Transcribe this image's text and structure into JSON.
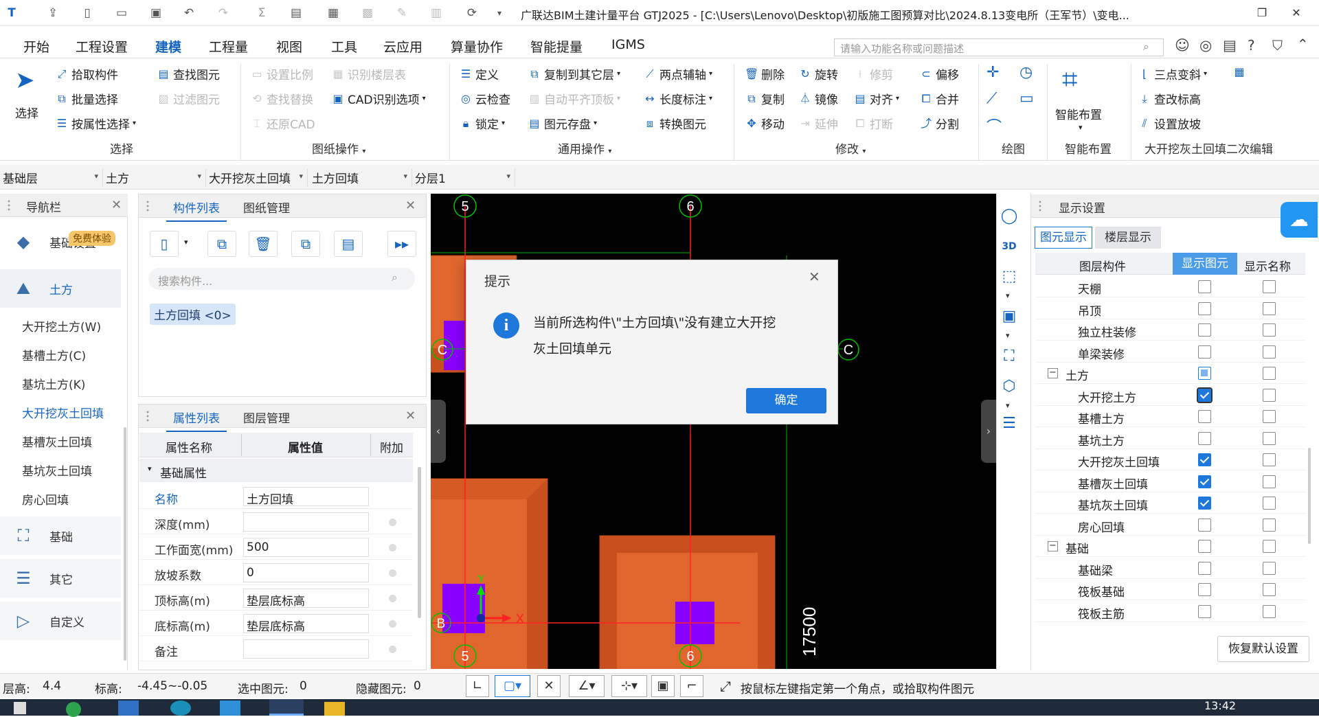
{
  "titlebar": {
    "title": "广联达BIM土建计量平台 GTJ2025 - [C:\\Users\\Lenovo\\Desktop\\初版施工图预算对比\\2024.8.13变电所（王军节）\\变电..."
  },
  "menu": {
    "items": [
      "开始",
      "工程设置",
      "建模",
      "工程量",
      "视图",
      "工具",
      "云应用",
      "算量协作",
      "智能提量",
      "IGMS"
    ],
    "active": "建模",
    "search_placeholder": "请输入功能名称或问题描述"
  },
  "ribbon": {
    "select": {
      "label": "选择",
      "group": "选择",
      "items": [
        "拾取构件",
        "批量选择",
        "按属性选择"
      ],
      "find": [
        "查找图元",
        "过滤图元"
      ]
    },
    "drawing": {
      "group": "图纸操作",
      "items": [
        "设置比例",
        "识别楼层表",
        "查找替换",
        "CAD识别选项",
        "还原CAD"
      ]
    },
    "common": {
      "group": "通用操作",
      "items": [
        "定义",
        "复制到其它层",
        "两点辅轴",
        "云检查",
        "自动平齐顶板",
        "长度标注",
        "锁定",
        "图元存盘",
        "转换图元"
      ]
    },
    "modify": {
      "group": "修改",
      "items": [
        "删除",
        "旋转",
        "修剪",
        "偏移",
        "复制",
        "镜像",
        "对齐",
        "合并",
        "移动",
        "延伸",
        "打断",
        "分割"
      ]
    },
    "draw": {
      "group": "绘图"
    },
    "smart": {
      "label": "智能布置",
      "group": "智能布置"
    },
    "edit2": {
      "group": "大开挖灰土回填二次编辑",
      "items": [
        "三点变斜",
        "查改标高",
        "设置放坡"
      ]
    }
  },
  "propbar": {
    "floor": "基础层",
    "type": "土方",
    "subtype": "大开挖灰土回填",
    "component": "土方回填",
    "layer": "分层1"
  },
  "nav": {
    "title": "导航栏",
    "promo": "免费体验",
    "categories": [
      {
        "label": "基础设置",
        "icon": "layers-icon"
      },
      {
        "label": "土方",
        "icon": "earthwork-icon"
      },
      {
        "label": "基础",
        "icon": "foundation-icon"
      },
      {
        "label": "其它",
        "icon": "stack-icon"
      },
      {
        "label": "自定义",
        "icon": "custom-icon"
      }
    ],
    "items": [
      "大开挖土方(W)",
      "基槽土方(C)",
      "基坑土方(K)",
      "大开挖灰土回填",
      "基槽灰土回填",
      "基坑灰土回填",
      "房心回填"
    ]
  },
  "comp_panel": {
    "tabs": [
      "构件列表",
      "图纸管理"
    ],
    "search_placeholder": "搜索构件...",
    "item": "土方回填 <0>"
  },
  "prop_panel": {
    "tabs": [
      "属性列表",
      "图层管理"
    ],
    "headers": [
      "属性名称",
      "属性值",
      "附加"
    ],
    "section": "基础属性",
    "rows": [
      {
        "name": "名称",
        "value": "土方回填"
      },
      {
        "name": "深度(mm)",
        "value": ""
      },
      {
        "name": "工作面宽(mm)",
        "value": "500"
      },
      {
        "name": "放坡系数",
        "value": "0"
      },
      {
        "name": "顶标高(m)",
        "value": "垫层底标高"
      },
      {
        "name": "底标高(m)",
        "value": "垫层底标高"
      },
      {
        "name": "备注",
        "value": ""
      }
    ]
  },
  "canvas": {
    "axes": [
      "5",
      "6",
      "C",
      "C",
      "5",
      "6"
    ],
    "dimension": "17500",
    "ucs_x": "X",
    "ucs_y": "Y"
  },
  "dialog": {
    "title": "提示",
    "message_line1": "当前所选构件\\\"土方回填\\\"没有建立大开挖",
    "message_line2": "灰土回填单元",
    "ok": "确定"
  },
  "display": {
    "title": "显示设置",
    "tabs": [
      "图元显示",
      "楼层显示"
    ],
    "headers": [
      "图层构件",
      "显示图元",
      "显示名称"
    ],
    "rows": [
      {
        "name": "天棚",
        "indent": 2,
        "show": "off",
        "label": "off"
      },
      {
        "name": "吊顶",
        "indent": 2,
        "show": "off",
        "label": "off"
      },
      {
        "name": "独立柱装修",
        "indent": 2,
        "show": "off",
        "label": "off"
      },
      {
        "name": "单梁装修",
        "indent": 2,
        "show": "off",
        "label": "off"
      },
      {
        "name": "土方",
        "indent": 1,
        "show": "part",
        "label": "off"
      },
      {
        "name": "大开挖土方",
        "indent": 2,
        "show": "on",
        "label": "off"
      },
      {
        "name": "基槽土方",
        "indent": 2,
        "show": "off",
        "label": "off"
      },
      {
        "name": "基坑土方",
        "indent": 2,
        "show": "off",
        "label": "off"
      },
      {
        "name": "大开挖灰土回填",
        "indent": 2,
        "show": "on",
        "label": "off"
      },
      {
        "name": "基槽灰土回填",
        "indent": 2,
        "show": "on",
        "label": "off"
      },
      {
        "name": "基坑灰土回填",
        "indent": 2,
        "show": "on",
        "label": "off"
      },
      {
        "name": "房心回填",
        "indent": 2,
        "show": "off",
        "label": "off"
      },
      {
        "name": "基础",
        "indent": 1,
        "show": "off",
        "label": "off"
      },
      {
        "name": "基础梁",
        "indent": 2,
        "show": "off",
        "label": "off"
      },
      {
        "name": "筏板基础",
        "indent": 2,
        "show": "off",
        "label": "off"
      },
      {
        "name": "筏板主筋",
        "indent": 2,
        "show": "off",
        "label": "off"
      }
    ],
    "reset": "恢复默认设置"
  },
  "status": {
    "floor_height_label": "层高:",
    "floor_height": "4.4",
    "elev_label": "标高:",
    "elev": "-4.45~-0.05",
    "selected_label": "选中图元:",
    "selected": "0",
    "hidden_label": "隐藏图元:",
    "hidden": "0",
    "hint": "按鼠标左键指定第一个角点，或拾取构件图元"
  },
  "taskbar": {
    "time": "13:42"
  },
  "colors": {
    "accent": "#1565c0",
    "earth": "#e0662e",
    "purple": "#8a00ff",
    "check": "#1e78dc"
  }
}
